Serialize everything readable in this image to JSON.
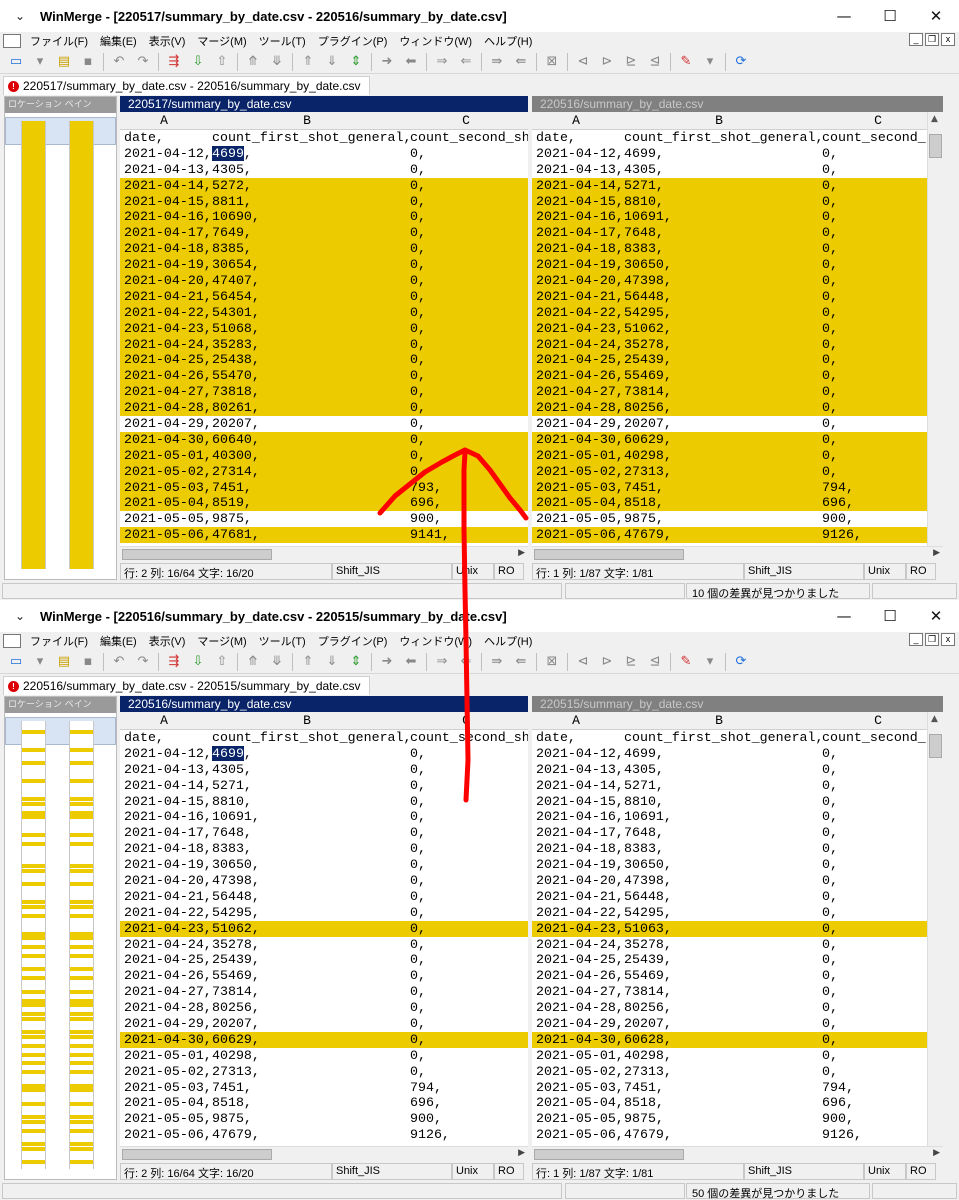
{
  "windows": [
    {
      "title": "WinMerge - [220517/summary_by_date.csv - 220516/summary_by_date.csv]",
      "tab_label": "220517/summary_by_date.csv - 220516/summary_by_date.csv",
      "left_header": "220517/summary_by_date.csv",
      "right_header": "220516/summary_by_date.csv",
      "left_status": {
        "pos": "行: 2  列: 16/64  文字: 16/20",
        "enc": "Shift_JIS",
        "eol": "Unix",
        "ro": "RO"
      },
      "right_status": {
        "pos": "行: 1  列: 1/87  文字: 1/81",
        "enc": "Shift_JIS",
        "eol": "Unix",
        "ro": "RO"
      },
      "global_status": "10 個の差異が見つかりました",
      "left_rows": [
        [
          "date,",
          "count_first_shot_general,",
          "count_second_sh"
        ],
        [
          "2021-04-12,",
          "4699,",
          "0,"
        ],
        [
          "2021-04-13,",
          "4305,",
          "0,"
        ],
        [
          "2021-04-14,",
          "5272,",
          "0,"
        ],
        [
          "2021-04-15,",
          "8811,",
          "0,"
        ],
        [
          "2021-04-16,",
          "10690,",
          "0,"
        ],
        [
          "2021-04-17,",
          "7649,",
          "0,"
        ],
        [
          "2021-04-18,",
          "8385,",
          "0,"
        ],
        [
          "2021-04-19,",
          "30654,",
          "0,"
        ],
        [
          "2021-04-20,",
          "47407,",
          "0,"
        ],
        [
          "2021-04-21,",
          "56454,",
          "0,"
        ],
        [
          "2021-04-22,",
          "54301,",
          "0,"
        ],
        [
          "2021-04-23,",
          "51068,",
          "0,"
        ],
        [
          "2021-04-24,",
          "35283,",
          "0,"
        ],
        [
          "2021-04-25,",
          "25438,",
          "0,"
        ],
        [
          "2021-04-26,",
          "55470,",
          "0,"
        ],
        [
          "2021-04-27,",
          "73818,",
          "0,"
        ],
        [
          "2021-04-28,",
          "80261,",
          "0,"
        ],
        [
          "2021-04-29,",
          "20207,",
          "0,"
        ],
        [
          "2021-04-30,",
          "60640,",
          "0,"
        ],
        [
          "2021-05-01,",
          "40300,",
          "0,"
        ],
        [
          "2021-05-02,",
          "27314,",
          "0,"
        ],
        [
          "2021-05-03,",
          "7451,",
          "793,"
        ],
        [
          "2021-05-04,",
          "8519,",
          "696,"
        ],
        [
          "2021-05-05,",
          "9875,",
          "900,"
        ],
        [
          "2021-05-06,",
          "47681,",
          "9141,"
        ]
      ],
      "right_rows": [
        [
          "date,",
          "count_first_shot_general,",
          "count_second_sh"
        ],
        [
          "2021-04-12,",
          "4699,",
          "0,"
        ],
        [
          "2021-04-13,",
          "4305,",
          "0,"
        ],
        [
          "2021-04-14,",
          "5271,",
          "0,"
        ],
        [
          "2021-04-15,",
          "8810,",
          "0,"
        ],
        [
          "2021-04-16,",
          "10691,",
          "0,"
        ],
        [
          "2021-04-17,",
          "7648,",
          "0,"
        ],
        [
          "2021-04-18,",
          "8383,",
          "0,"
        ],
        [
          "2021-04-19,",
          "30650,",
          "0,"
        ],
        [
          "2021-04-20,",
          "47398,",
          "0,"
        ],
        [
          "2021-04-21,",
          "56448,",
          "0,"
        ],
        [
          "2021-04-22,",
          "54295,",
          "0,"
        ],
        [
          "2021-04-23,",
          "51062,",
          "0,"
        ],
        [
          "2021-04-24,",
          "35278,",
          "0,"
        ],
        [
          "2021-04-25,",
          "25439,",
          "0,"
        ],
        [
          "2021-04-26,",
          "55469,",
          "0,"
        ],
        [
          "2021-04-27,",
          "73814,",
          "0,"
        ],
        [
          "2021-04-28,",
          "80256,",
          "0,"
        ],
        [
          "2021-04-29,",
          "20207,",
          "0,"
        ],
        [
          "2021-04-30,",
          "60629,",
          "0,"
        ],
        [
          "2021-05-01,",
          "40298,",
          "0,"
        ],
        [
          "2021-05-02,",
          "27313,",
          "0,"
        ],
        [
          "2021-05-03,",
          "7451,",
          "794,"
        ],
        [
          "2021-05-04,",
          "8518,",
          "696,"
        ],
        [
          "2021-05-05,",
          "9875,",
          "900,"
        ],
        [
          "2021-05-06,",
          "47679,",
          "9126,"
        ]
      ],
      "diff_rows": [
        3,
        4,
        5,
        6,
        7,
        8,
        9,
        10,
        11,
        12,
        13,
        14,
        15,
        16,
        17,
        19,
        20,
        21,
        22,
        23,
        25
      ],
      "loc_stripes": []
    },
    {
      "title": "WinMerge - [220516/summary_by_date.csv - 220515/summary_by_date.csv]",
      "tab_label": "220516/summary_by_date.csv - 220515/summary_by_date.csv",
      "left_header": "220516/summary_by_date.csv",
      "right_header": "220515/summary_by_date.csv",
      "left_status": {
        "pos": "行: 2  列: 16/64  文字: 16/20",
        "enc": "Shift_JIS",
        "eol": "Unix",
        "ro": "RO"
      },
      "right_status": {
        "pos": "行: 1  列: 1/87  文字: 1/81",
        "enc": "Shift_JIS",
        "eol": "Unix",
        "ro": "RO"
      },
      "global_status": "50 個の差異が見つかりました",
      "left_rows": [
        [
          "date,",
          "count_first_shot_general,",
          "count_second_sh"
        ],
        [
          "2021-04-12,",
          "4699,",
          "0,"
        ],
        [
          "2021-04-13,",
          "4305,",
          "0,"
        ],
        [
          "2021-04-14,",
          "5271,",
          "0,"
        ],
        [
          "2021-04-15,",
          "8810,",
          "0,"
        ],
        [
          "2021-04-16,",
          "10691,",
          "0,"
        ],
        [
          "2021-04-17,",
          "7648,",
          "0,"
        ],
        [
          "2021-04-18,",
          "8383,",
          "0,"
        ],
        [
          "2021-04-19,",
          "30650,",
          "0,"
        ],
        [
          "2021-04-20,",
          "47398,",
          "0,"
        ],
        [
          "2021-04-21,",
          "56448,",
          "0,"
        ],
        [
          "2021-04-22,",
          "54295,",
          "0,"
        ],
        [
          "2021-04-23,",
          "51062,",
          "0,"
        ],
        [
          "2021-04-24,",
          "35278,",
          "0,"
        ],
        [
          "2021-04-25,",
          "25439,",
          "0,"
        ],
        [
          "2021-04-26,",
          "55469,",
          "0,"
        ],
        [
          "2021-04-27,",
          "73814,",
          "0,"
        ],
        [
          "2021-04-28,",
          "80256,",
          "0,"
        ],
        [
          "2021-04-29,",
          "20207,",
          "0,"
        ],
        [
          "2021-04-30,",
          "60629,",
          "0,"
        ],
        [
          "2021-05-01,",
          "40298,",
          "0,"
        ],
        [
          "2021-05-02,",
          "27313,",
          "0,"
        ],
        [
          "2021-05-03,",
          "7451,",
          "794,"
        ],
        [
          "2021-05-04,",
          "8518,",
          "696,"
        ],
        [
          "2021-05-05,",
          "9875,",
          "900,"
        ],
        [
          "2021-05-06,",
          "47679,",
          "9126,"
        ]
      ],
      "right_rows": [
        [
          "date,",
          "count_first_shot_general,",
          "count_second_sh"
        ],
        [
          "2021-04-12,",
          "4699,",
          "0,"
        ],
        [
          "2021-04-13,",
          "4305,",
          "0,"
        ],
        [
          "2021-04-14,",
          "5271,",
          "0,"
        ],
        [
          "2021-04-15,",
          "8810,",
          "0,"
        ],
        [
          "2021-04-16,",
          "10691,",
          "0,"
        ],
        [
          "2021-04-17,",
          "7648,",
          "0,"
        ],
        [
          "2021-04-18,",
          "8383,",
          "0,"
        ],
        [
          "2021-04-19,",
          "30650,",
          "0,"
        ],
        [
          "2021-04-20,",
          "47398,",
          "0,"
        ],
        [
          "2021-04-21,",
          "56448,",
          "0,"
        ],
        [
          "2021-04-22,",
          "54295,",
          "0,"
        ],
        [
          "2021-04-23,",
          "51063,",
          "0,"
        ],
        [
          "2021-04-24,",
          "35278,",
          "0,"
        ],
        [
          "2021-04-25,",
          "25439,",
          "0,"
        ],
        [
          "2021-04-26,",
          "55469,",
          "0,"
        ],
        [
          "2021-04-27,",
          "73814,",
          "0,"
        ],
        [
          "2021-04-28,",
          "80256,",
          "0,"
        ],
        [
          "2021-04-29,",
          "20207,",
          "0,"
        ],
        [
          "2021-04-30,",
          "60628,",
          "0,"
        ],
        [
          "2021-05-01,",
          "40298,",
          "0,"
        ],
        [
          "2021-05-02,",
          "27313,",
          "0,"
        ],
        [
          "2021-05-03,",
          "7451,",
          "794,"
        ],
        [
          "2021-05-04,",
          "8518,",
          "696,"
        ],
        [
          "2021-05-05,",
          "9875,",
          "900,"
        ],
        [
          "2021-05-06,",
          "47679,",
          "9126,"
        ]
      ],
      "diff_rows": [
        12,
        19
      ],
      "loc_stripes": [
        2,
        6,
        9,
        13,
        17,
        18,
        20,
        21,
        25,
        27,
        32,
        33,
        36,
        40,
        41,
        43,
        47,
        48,
        50,
        52,
        55,
        57,
        60,
        62,
        63,
        65,
        66,
        69,
        70,
        72,
        74,
        76,
        78,
        81,
        82,
        85,
        88,
        89,
        91,
        94,
        95,
        98
      ]
    }
  ],
  "menu": [
    "ファイル(F)",
    "編集(E)",
    "表示(V)",
    "マージ(M)",
    "ツール(T)",
    "プラグイン(P)",
    "ウィンドウ(W)",
    "ヘルプ(H)"
  ],
  "location_pane_label": "ロケーション ペイン",
  "column_letters": [
    "A",
    "B",
    "C"
  ],
  "controls": {
    "minimize": "—",
    "maximize": "☐",
    "close": "✕",
    "sysmenu": "⌄"
  },
  "colors": {
    "diff": "#eccb00",
    "active_header": "#0a246a",
    "inactive_header": "#808080",
    "annotation": "#ff0000"
  },
  "annotation": "red arrow drawn from lower window pointing up to the upper window's highlighted changed rows"
}
